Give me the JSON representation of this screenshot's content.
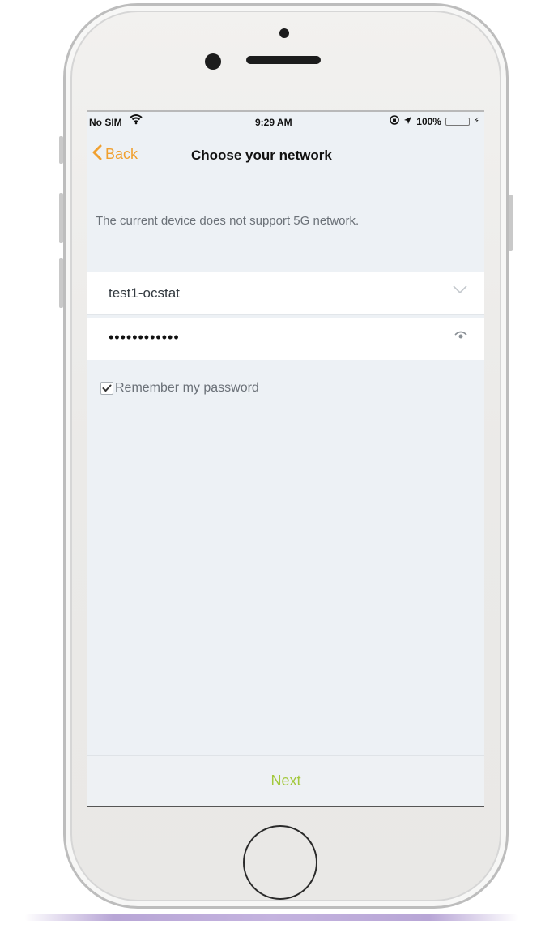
{
  "status_bar": {
    "carrier": "No SIM",
    "time": "9:29 AM",
    "battery_percent": "100%",
    "battery_level": 1.0,
    "battery_color": "#4cd964"
  },
  "nav": {
    "back_label": "Back",
    "title": "Choose your network"
  },
  "notice_text": "The current device does not support 5G network.",
  "network_field": {
    "value": "test1-ocstat",
    "trailing_icon": "chevron-down-icon"
  },
  "password_field": {
    "value": "••••••••••••",
    "trailing_icon": "eye-icon"
  },
  "remember": {
    "label": "Remember my password",
    "checked": true
  },
  "next_label": "Next",
  "colors": {
    "accent_back": "#f0a030",
    "next_text": "#a3c83c",
    "screen_bg": "#edf1f5"
  }
}
